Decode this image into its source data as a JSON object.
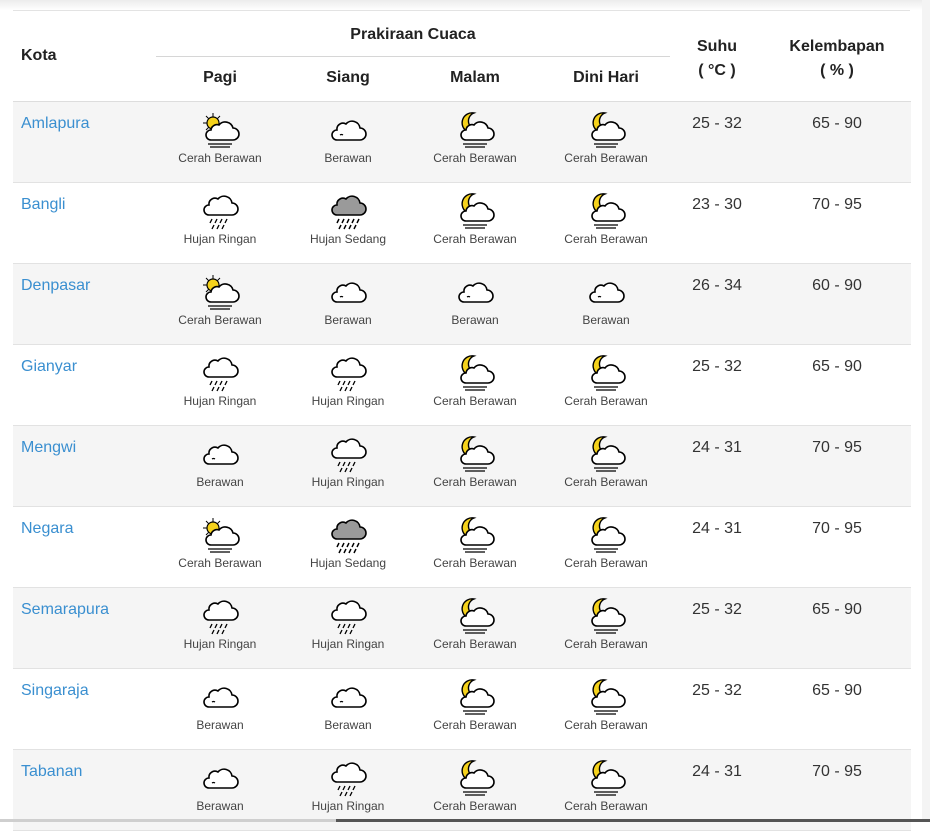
{
  "header": {
    "kota": "Kota",
    "forecast_group": "Prakiraan Cuaca",
    "periods": [
      "Pagi",
      "Siang",
      "Malam",
      "Dini Hari"
    ],
    "suhu_title": "Suhu",
    "suhu_unit": "( °C )",
    "kelembapan_title": "Kelembapan",
    "kelembapan_unit": "( % )"
  },
  "rows": [
    {
      "city": "Amlapura",
      "cells": [
        {
          "icon": "partly-cloudy-day",
          "label": "Cerah Berawan"
        },
        {
          "icon": "cloudy",
          "label": "Berawan"
        },
        {
          "icon": "partly-cloudy-night",
          "label": "Cerah Berawan"
        },
        {
          "icon": "partly-cloudy-night",
          "label": "Cerah Berawan"
        }
      ],
      "temp": "25 - 32",
      "humidity": "65 - 90"
    },
    {
      "city": "Bangli",
      "cells": [
        {
          "icon": "light-rain",
          "label": "Hujan Ringan"
        },
        {
          "icon": "moderate-rain",
          "label": "Hujan Sedang"
        },
        {
          "icon": "partly-cloudy-night",
          "label": "Cerah Berawan"
        },
        {
          "icon": "partly-cloudy-night",
          "label": "Cerah Berawan"
        }
      ],
      "temp": "23 - 30",
      "humidity": "70 - 95"
    },
    {
      "city": "Denpasar",
      "cells": [
        {
          "icon": "partly-cloudy-day",
          "label": "Cerah Berawan"
        },
        {
          "icon": "cloudy",
          "label": "Berawan"
        },
        {
          "icon": "cloudy",
          "label": "Berawan"
        },
        {
          "icon": "cloudy",
          "label": "Berawan"
        }
      ],
      "temp": "26 - 34",
      "humidity": "60 - 90"
    },
    {
      "city": "Gianyar",
      "cells": [
        {
          "icon": "light-rain",
          "label": "Hujan Ringan"
        },
        {
          "icon": "light-rain",
          "label": "Hujan Ringan"
        },
        {
          "icon": "partly-cloudy-night",
          "label": "Cerah Berawan"
        },
        {
          "icon": "partly-cloudy-night",
          "label": "Cerah Berawan"
        }
      ],
      "temp": "25 - 32",
      "humidity": "65 - 90"
    },
    {
      "city": "Mengwi",
      "cells": [
        {
          "icon": "cloudy",
          "label": "Berawan"
        },
        {
          "icon": "light-rain",
          "label": "Hujan Ringan"
        },
        {
          "icon": "partly-cloudy-night",
          "label": "Cerah Berawan"
        },
        {
          "icon": "partly-cloudy-night",
          "label": "Cerah Berawan"
        }
      ],
      "temp": "24 - 31",
      "humidity": "70 - 95"
    },
    {
      "city": "Negara",
      "cells": [
        {
          "icon": "partly-cloudy-day",
          "label": "Cerah Berawan"
        },
        {
          "icon": "moderate-rain",
          "label": "Hujan Sedang"
        },
        {
          "icon": "partly-cloudy-night",
          "label": "Cerah Berawan"
        },
        {
          "icon": "partly-cloudy-night",
          "label": "Cerah Berawan"
        }
      ],
      "temp": "24 - 31",
      "humidity": "70 - 95"
    },
    {
      "city": "Semarapura",
      "cells": [
        {
          "icon": "light-rain",
          "label": "Hujan Ringan"
        },
        {
          "icon": "light-rain",
          "label": "Hujan Ringan"
        },
        {
          "icon": "partly-cloudy-night",
          "label": "Cerah Berawan"
        },
        {
          "icon": "partly-cloudy-night",
          "label": "Cerah Berawan"
        }
      ],
      "temp": "25 - 32",
      "humidity": "65 - 90"
    },
    {
      "city": "Singaraja",
      "cells": [
        {
          "icon": "cloudy",
          "label": "Berawan"
        },
        {
          "icon": "cloudy",
          "label": "Berawan"
        },
        {
          "icon": "partly-cloudy-night",
          "label": "Cerah Berawan"
        },
        {
          "icon": "partly-cloudy-night",
          "label": "Cerah Berawan"
        }
      ],
      "temp": "25 - 32",
      "humidity": "65 - 90"
    },
    {
      "city": "Tabanan",
      "cells": [
        {
          "icon": "cloudy",
          "label": "Berawan"
        },
        {
          "icon": "light-rain",
          "label": "Hujan Ringan"
        },
        {
          "icon": "partly-cloudy-night",
          "label": "Cerah Berawan"
        },
        {
          "icon": "partly-cloudy-night",
          "label": "Cerah Berawan"
        }
      ],
      "temp": "24 - 31",
      "humidity": "70 - 95"
    }
  ],
  "colors": {
    "link": "#3a8fd0",
    "sun_moon": "#f5d21c",
    "rain_cloud": "#9a9a9a",
    "row_shade": "#f5f5f5"
  }
}
